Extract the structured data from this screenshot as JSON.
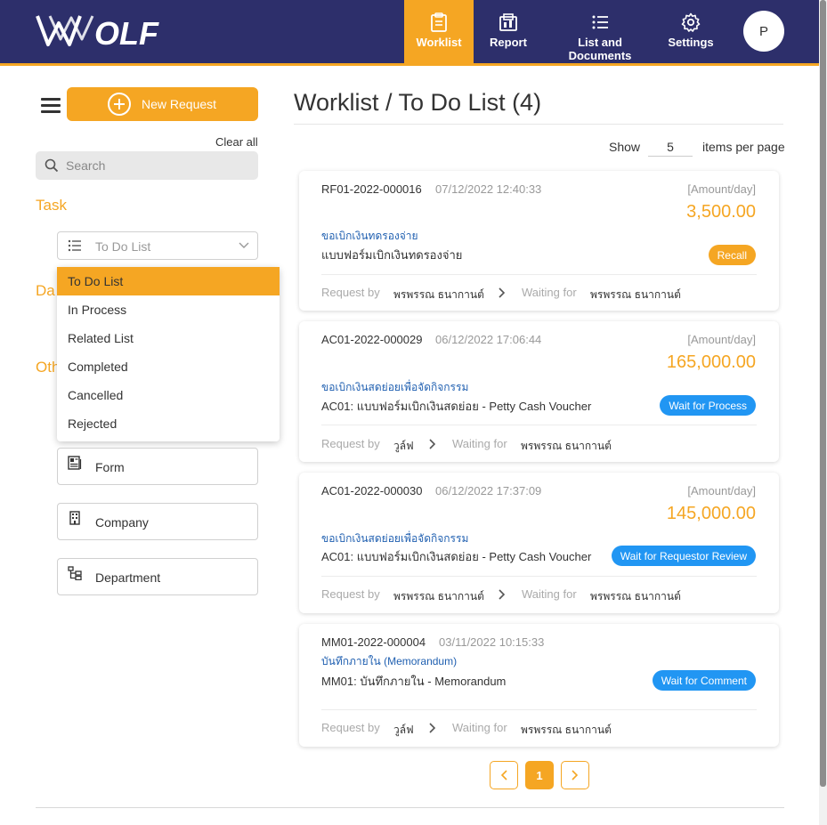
{
  "header": {
    "logo_text": "WOLF",
    "nav": [
      {
        "label": "Worklist",
        "icon": "clipboard-icon",
        "active": true
      },
      {
        "label": "Report",
        "icon": "report-icon",
        "active": false
      },
      {
        "label": "List and Documents",
        "icon": "list-icon",
        "active": false
      },
      {
        "label": "Settings",
        "icon": "gear-icon",
        "active": false
      }
    ],
    "avatar_initial": "P"
  },
  "colors": {
    "navy": "#2d2f6b",
    "accent": "#f5a623",
    "link": "#1f5fb0",
    "badge_blue": "#2196f3"
  },
  "sidebar": {
    "new_request_label": "New Request",
    "clear_all_label": "Clear all",
    "search_placeholder": "Search",
    "task_heading": "Task",
    "task_select_value": "To Do List",
    "task_options": [
      "To Do List",
      "In Process",
      "Related List",
      "Completed",
      "Cancelled",
      "Rejected"
    ],
    "date_heading_visible": "Da",
    "other_heading_visible": "Oth",
    "filter_buttons": [
      {
        "label": "Form",
        "icon": "form-icon"
      },
      {
        "label": "Company",
        "icon": "building-icon"
      },
      {
        "label": "Department",
        "icon": "org-chart-icon"
      }
    ]
  },
  "main": {
    "title": "Worklist / To Do List (4)",
    "show_label": "Show",
    "items_per_page": "5",
    "items_per_page_label": "items per page",
    "cards": [
      {
        "doc_no": "RF01-2022-000016",
        "date": "07/12/2022 12:40:33",
        "amount_label": "[Amount/day]",
        "amount": "3,500.00",
        "category": "ขอเบิกเงินทดรองจ่าย",
        "form_name": "แบบฟอร์มเบิกเงินทดรองจ่าย",
        "status": "Recall",
        "status_color": "#f5a623",
        "request_by_label": "Request by",
        "request_by": "พรพรรณ ธนากานต์",
        "waiting_for_label": "Waiting for",
        "waiting_for": "พรพรรณ ธนากานต์"
      },
      {
        "doc_no": "AC01-2022-000029",
        "date": "06/12/2022 17:06:44",
        "amount_label": "[Amount/day]",
        "amount": "165,000.00",
        "category": "ขอเบิกเงินสดย่อยเพื่อจัดกิจกรรม",
        "form_name": "AC01: แบบฟอร์มเบิกเงินสดย่อย - Petty Cash Voucher",
        "status": "Wait for Process",
        "status_color": "#2196f3",
        "request_by_label": "Request by",
        "request_by": "วูล์ฟ",
        "waiting_for_label": "Waiting for",
        "waiting_for": "พรพรรณ ธนากานต์"
      },
      {
        "doc_no": "AC01-2022-000030",
        "date": "06/12/2022 17:37:09",
        "amount_label": "[Amount/day]",
        "amount": "145,000.00",
        "category": "ขอเบิกเงินสดย่อยเพื่อจัดกิจกรรม",
        "form_name": "AC01: แบบฟอร์มเบิกเงินสดย่อย - Petty Cash Voucher",
        "status": "Wait for Requestor Review",
        "status_color": "#2196f3",
        "request_by_label": "Request by",
        "request_by": "พรพรรณ ธนากานต์",
        "waiting_for_label": "Waiting for",
        "waiting_for": "พรพรรณ ธนากานต์"
      },
      {
        "doc_no": "MM01-2022-000004",
        "date": "03/11/2022 10:15:33",
        "amount_label": "",
        "amount": "",
        "category": "บันทึกภายใน (Memorandum)",
        "form_name": "MM01: บันทึกภายใน - Memorandum",
        "status": "Wait for Comment",
        "status_color": "#2196f3",
        "request_by_label": "Request by",
        "request_by": "วูล์ฟ",
        "waiting_for_label": "Waiting for",
        "waiting_for": "พรพรรณ ธนากานต์"
      }
    ],
    "pagination": {
      "current": "1",
      "prev_icon": "chevron-left-icon",
      "next_icon": "chevron-right-icon"
    }
  }
}
